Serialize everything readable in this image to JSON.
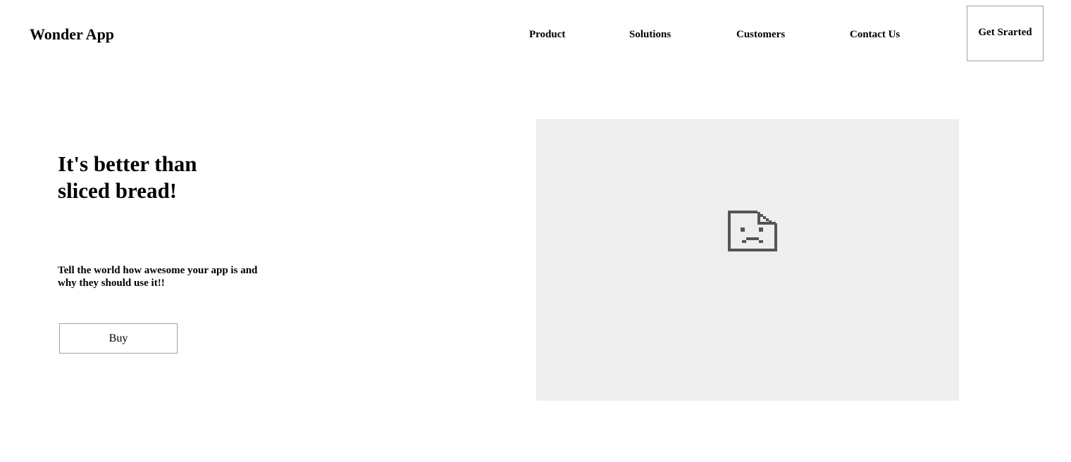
{
  "header": {
    "brand": "Wonder App",
    "nav": {
      "product": "Product",
      "solutions": "Solutions",
      "customers": "Customers",
      "contact": "Contact Us"
    },
    "cta_label": "Get Srarted"
  },
  "hero": {
    "title_line1": "It's better than",
    "title_line2": "sliced bread!",
    "subtitle_line1": "Tell the world how awesome your app is and",
    "subtitle_line2": "why they should use it!!",
    "buy_label": "Buy",
    "image_icon": "broken-image-icon"
  },
  "colors": {
    "placeholder_bg": "#eeeeee",
    "icon": "#555555",
    "button_border": "#a0a0a0"
  }
}
